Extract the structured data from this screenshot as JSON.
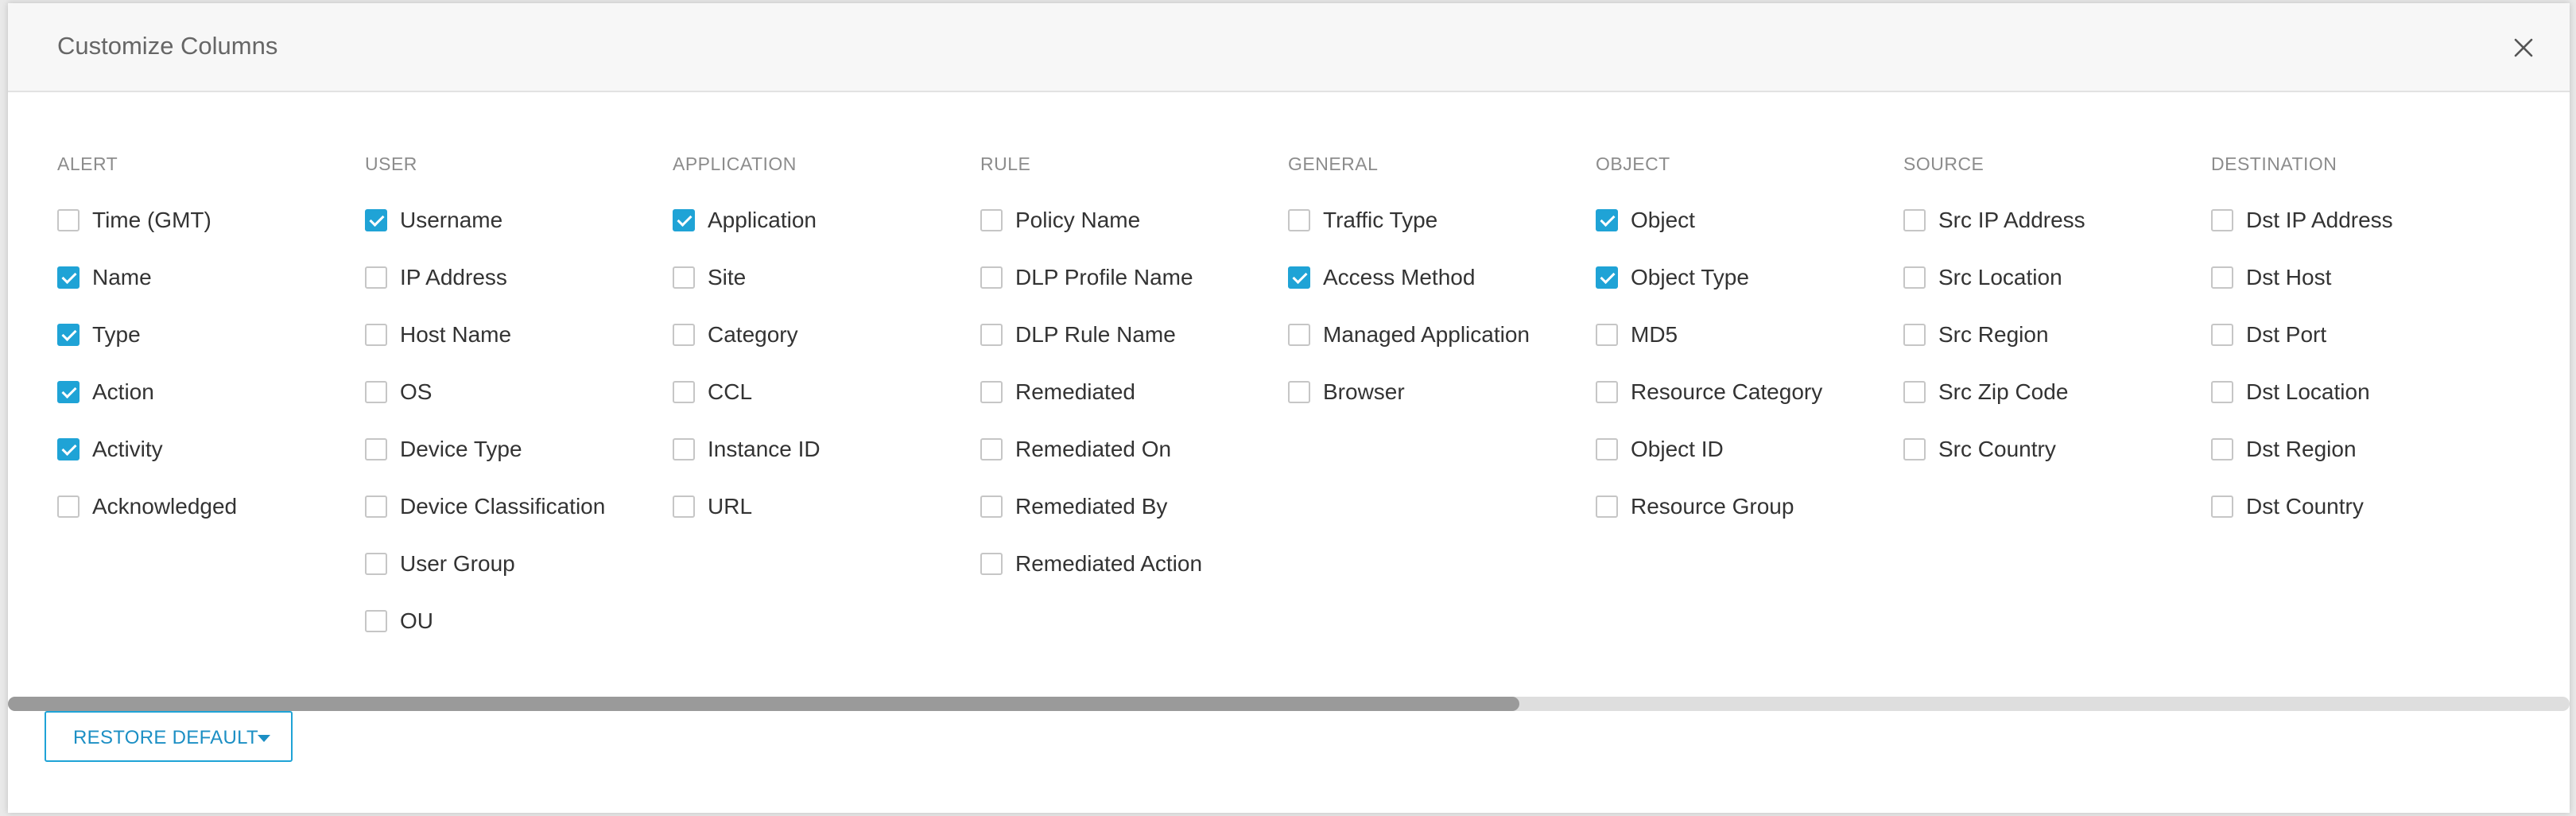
{
  "dialog": {
    "title": "Customize Columns",
    "close_icon": "close-icon"
  },
  "colors": {
    "accent": "#1fa3d6",
    "header_bg": "#f7f7f7"
  },
  "columns": [
    {
      "header": "ALERT",
      "options": [
        {
          "label": "Time (GMT)",
          "checked": false
        },
        {
          "label": "Name",
          "checked": true
        },
        {
          "label": "Type",
          "checked": true
        },
        {
          "label": "Action",
          "checked": true
        },
        {
          "label": "Activity",
          "checked": true
        },
        {
          "label": "Acknowledged",
          "checked": false
        }
      ]
    },
    {
      "header": "USER",
      "options": [
        {
          "label": "Username",
          "checked": true
        },
        {
          "label": "IP Address",
          "checked": false
        },
        {
          "label": "Host Name",
          "checked": false
        },
        {
          "label": "OS",
          "checked": false
        },
        {
          "label": "Device Type",
          "checked": false
        },
        {
          "label": "Device Classification",
          "checked": false
        },
        {
          "label": "User Group",
          "checked": false
        },
        {
          "label": "OU",
          "checked": false
        }
      ]
    },
    {
      "header": "APPLICATION",
      "options": [
        {
          "label": "Application",
          "checked": true
        },
        {
          "label": "Site",
          "checked": false
        },
        {
          "label": "Category",
          "checked": false
        },
        {
          "label": "CCL",
          "checked": false
        },
        {
          "label": "Instance ID",
          "checked": false
        },
        {
          "label": "URL",
          "checked": false
        }
      ]
    },
    {
      "header": "RULE",
      "options": [
        {
          "label": "Policy Name",
          "checked": false
        },
        {
          "label": "DLP Profile Name",
          "checked": false
        },
        {
          "label": "DLP Rule Name",
          "checked": false
        },
        {
          "label": "Remediated",
          "checked": false
        },
        {
          "label": "Remediated On",
          "checked": false
        },
        {
          "label": "Remediated By",
          "checked": false
        },
        {
          "label": "Remediated Action",
          "checked": false
        }
      ]
    },
    {
      "header": "GENERAL",
      "options": [
        {
          "label": "Traffic Type",
          "checked": false
        },
        {
          "label": "Access Method",
          "checked": true
        },
        {
          "label": "Managed Application",
          "checked": false
        },
        {
          "label": "Browser",
          "checked": false
        }
      ]
    },
    {
      "header": "OBJECT",
      "options": [
        {
          "label": "Object",
          "checked": true
        },
        {
          "label": "Object Type",
          "checked": true
        },
        {
          "label": "MD5",
          "checked": false
        },
        {
          "label": "Resource Category",
          "checked": false
        },
        {
          "label": "Object ID",
          "checked": false
        },
        {
          "label": "Resource Group",
          "checked": false
        }
      ]
    },
    {
      "header": "SOURCE",
      "options": [
        {
          "label": "Src IP Address",
          "checked": false
        },
        {
          "label": "Src Location",
          "checked": false
        },
        {
          "label": "Src Region",
          "checked": false
        },
        {
          "label": "Src Zip Code",
          "checked": false
        },
        {
          "label": "Src Country",
          "checked": false
        }
      ]
    },
    {
      "header": "DESTINATION",
      "options": [
        {
          "label": "Dst IP Address",
          "checked": false
        },
        {
          "label": "Dst Host",
          "checked": false
        },
        {
          "label": "Dst Port",
          "checked": false
        },
        {
          "label": "Dst Location",
          "checked": false
        },
        {
          "label": "Dst Region",
          "checked": false
        },
        {
          "label": "Dst Country",
          "checked": false
        }
      ]
    }
  ],
  "scrollbar": {
    "thumb_fraction": 0.59
  },
  "footer": {
    "restore_label": "RESTORE DEFAULT",
    "caret_icon": "caret-down-icon"
  }
}
